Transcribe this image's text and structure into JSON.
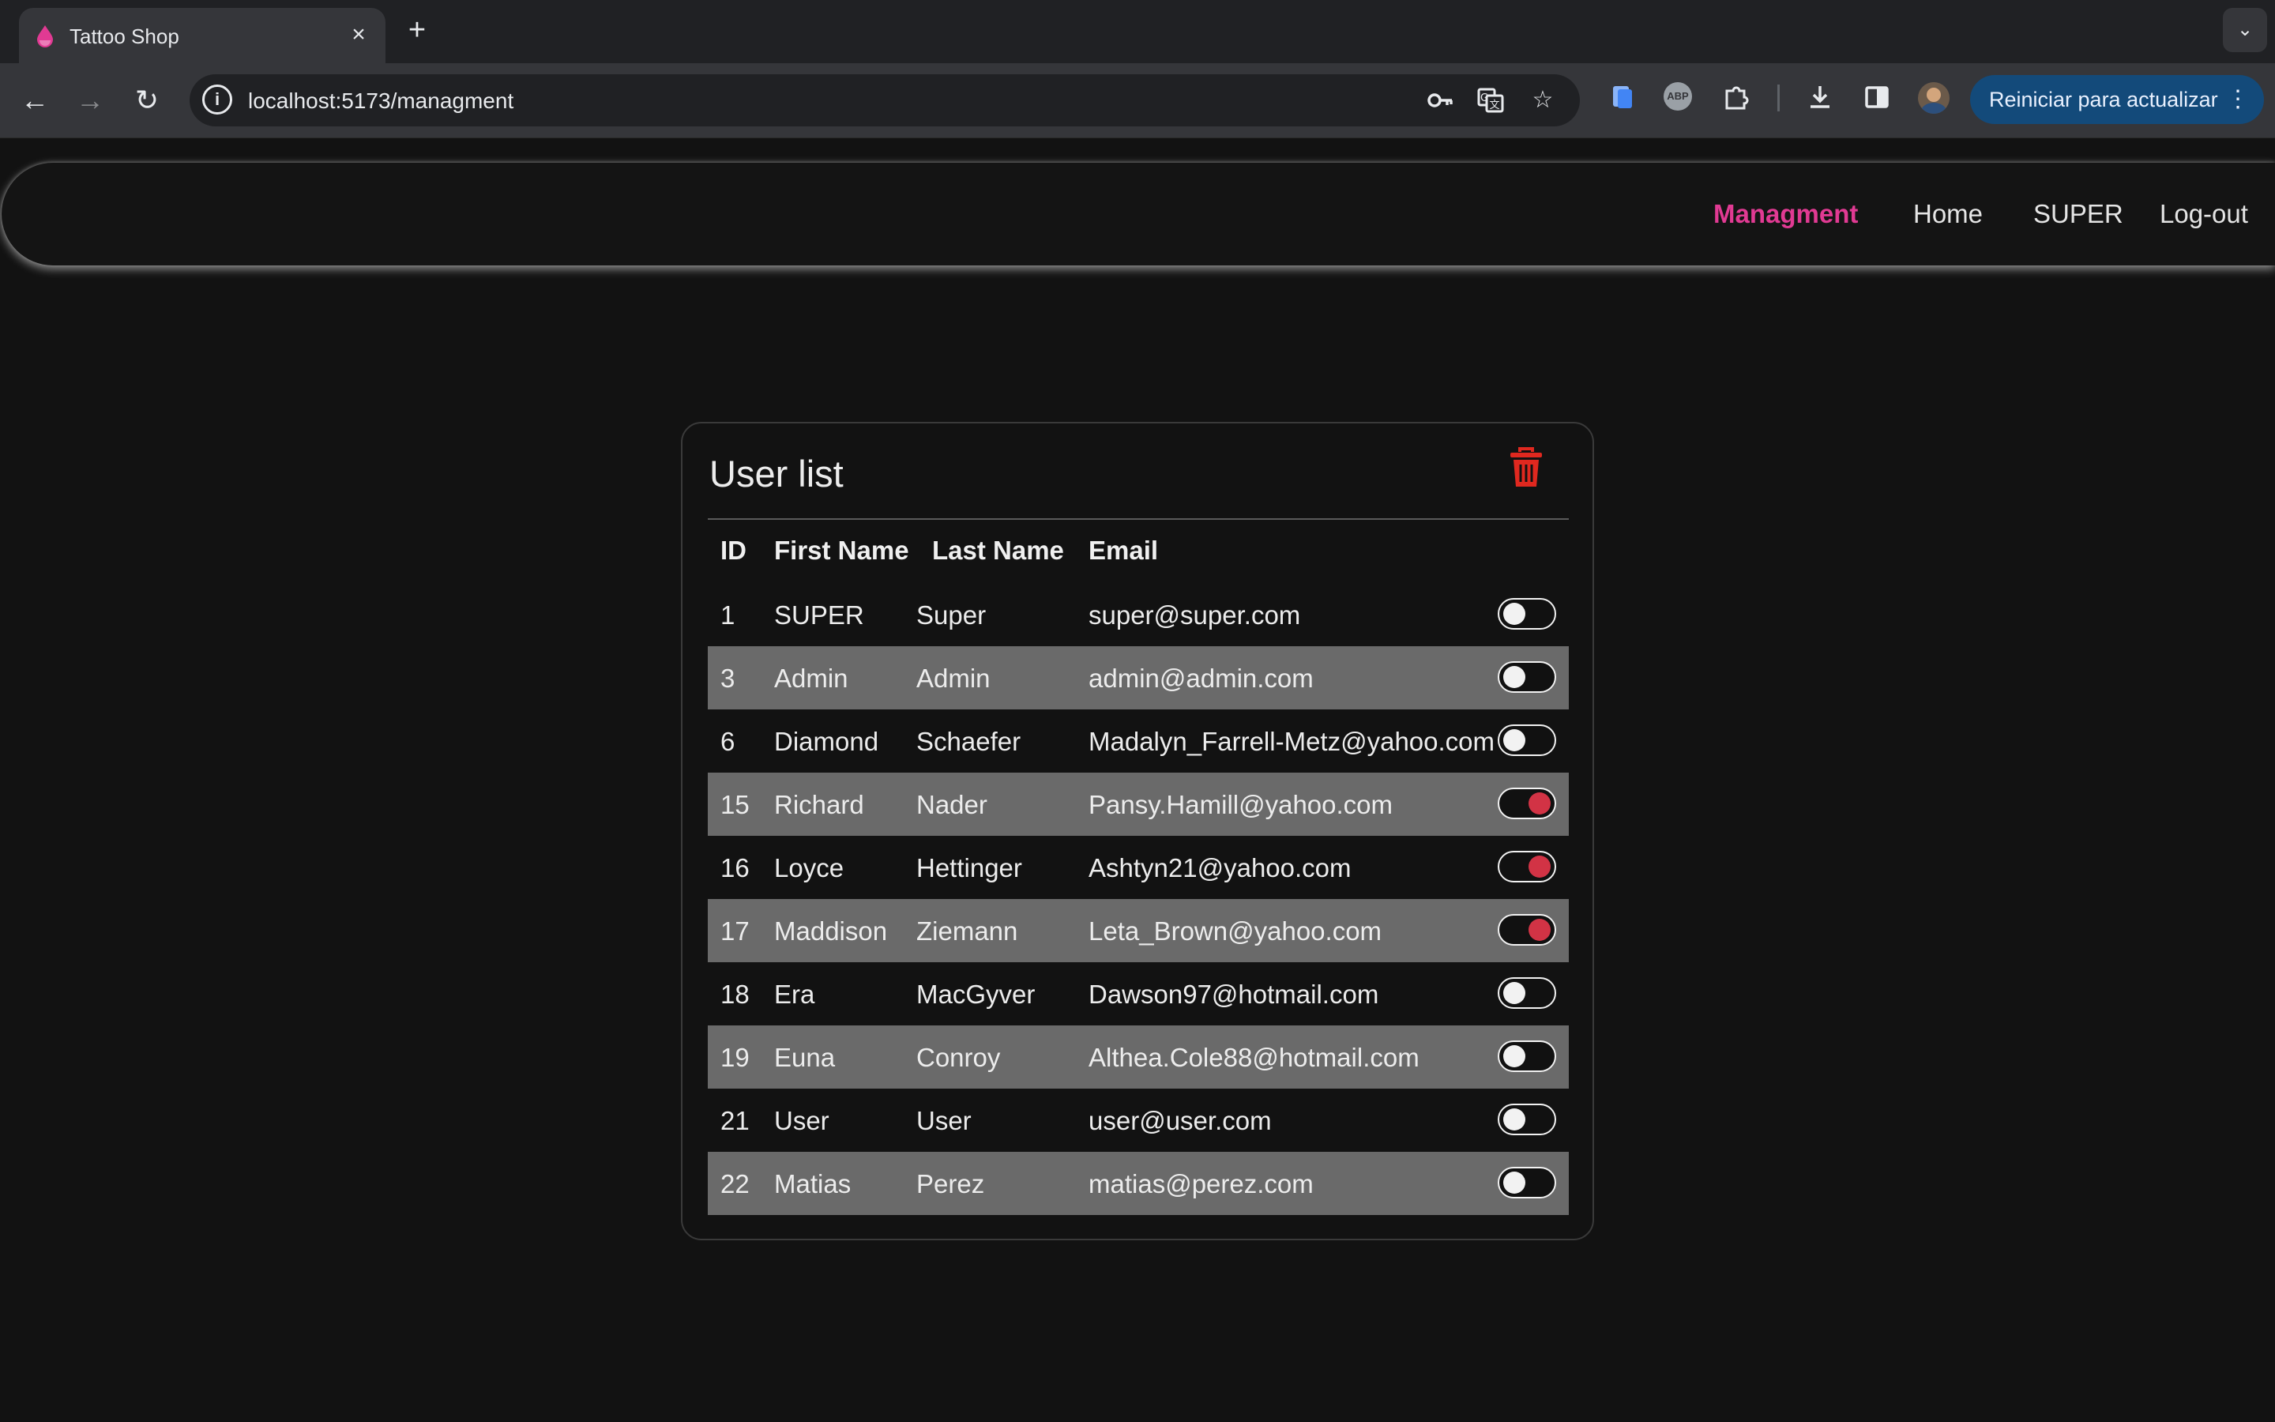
{
  "browser": {
    "tab_title": "Tattoo Shop",
    "url": "localhost:5173/managment",
    "update_button": "Reiniciar para actualizar"
  },
  "nav": {
    "links": [
      "Managment",
      "Home",
      "SUPER",
      "Log-out"
    ],
    "active": "Managment",
    "active_color": "#e13a93"
  },
  "user_list": {
    "title": "User list",
    "columns": [
      "ID",
      "First Name",
      "Last Name",
      "Email"
    ],
    "rows": [
      {
        "id": "1",
        "first": "SUPER",
        "last": "Super",
        "email": "super@super.com",
        "enabled": false
      },
      {
        "id": "3",
        "first": "Admin",
        "last": "Admin",
        "email": "admin@admin.com",
        "enabled": false
      },
      {
        "id": "6",
        "first": "Diamond",
        "last": "Schaefer",
        "email": "Madalyn_Farrell-Metz@yahoo.com",
        "enabled": false
      },
      {
        "id": "15",
        "first": "Richard",
        "last": "Nader",
        "email": "Pansy.Hamill@yahoo.com",
        "enabled": true
      },
      {
        "id": "16",
        "first": "Loyce",
        "last": "Hettinger",
        "email": "Ashtyn21@yahoo.com",
        "enabled": true
      },
      {
        "id": "17",
        "first": "Maddison",
        "last": "Ziemann",
        "email": "Leta_Brown@yahoo.com",
        "enabled": true
      },
      {
        "id": "18",
        "first": "Era",
        "last": "MacGyver",
        "email": "Dawson97@hotmail.com",
        "enabled": false
      },
      {
        "id": "19",
        "first": "Euna",
        "last": "Conroy",
        "email": "Althea.Cole88@hotmail.com",
        "enabled": false
      },
      {
        "id": "21",
        "first": "User",
        "last": "User",
        "email": "user@user.com",
        "enabled": false
      },
      {
        "id": "22",
        "first": "Matias",
        "last": "Perez",
        "email": "matias@perez.com",
        "enabled": false
      }
    ],
    "toggle_on_color": "#d23345",
    "delete_icon_color": "#e0281f"
  }
}
